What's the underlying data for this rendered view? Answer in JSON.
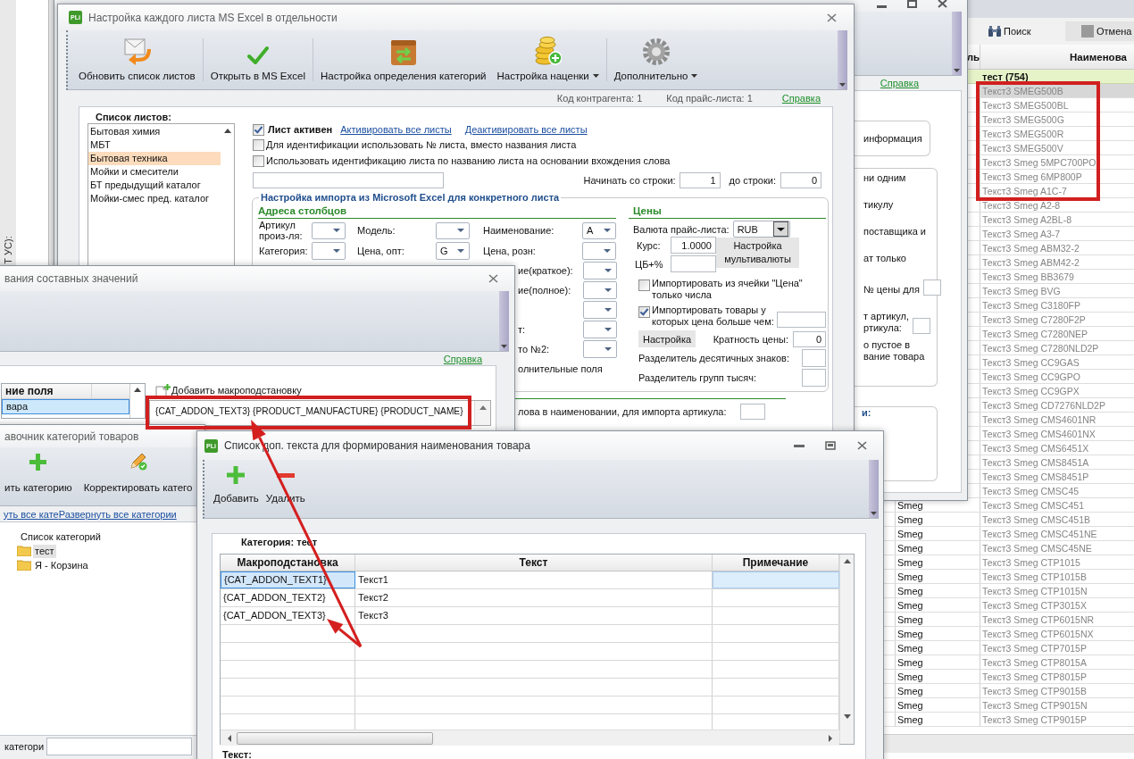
{
  "background_app": {
    "side_label": "Т УС):",
    "toolbar": [
      {
        "kind": "search",
        "label": "Поиск"
      },
      {
        "kind": "cancel",
        "label": "Отмена"
      }
    ],
    "table": {
      "columns": [
        "ль",
        "Наименова"
      ],
      "group_row": "тест (754)",
      "rows": [
        {
          "name": "Текст3 SMEG500B",
          "selected": true
        },
        {
          "name": "Текст3 SMEG500BL",
          "selected": false
        },
        {
          "name": "Текст3 SMEG500G",
          "selected": false
        },
        {
          "name": "Текст3 SMEG500R",
          "selected": false
        },
        {
          "name": "Текст3 SMEG500V",
          "selected": false
        },
        {
          "name": "Текст3 Smeg 5MPC700PO",
          "selected": false
        },
        {
          "name": "Текст3 Smeg 6MP800P",
          "selected": false
        },
        {
          "name": "Текст3 Smeg A1C-7",
          "selected": false
        },
        {
          "name": "Текст3 Smeg A2-8",
          "selected": false
        },
        {
          "name": "Текст3 Smeg A2BL-8",
          "selected": false
        },
        {
          "name": "Текст3 Smeg A3-7",
          "selected": false
        },
        {
          "name": "Текст3 Smeg ABM32-2",
          "selected": false
        },
        {
          "name": "Текст3 Smeg ABM42-2",
          "selected": false
        },
        {
          "name": "Текст3 Smeg BB3679",
          "selected": false
        },
        {
          "name": "Текст3 Smeg BVG",
          "selected": false
        },
        {
          "name": "Текст3 Smeg C3180FP",
          "selected": false
        },
        {
          "name": "Текст3 Smeg C7280F2P",
          "selected": false
        },
        {
          "name": "Текст3 Smeg C7280NEP",
          "selected": false
        },
        {
          "name": "Текст3 Smeg C7280NLD2P",
          "selected": false
        },
        {
          "name": "Текст3 Smeg CC9GAS",
          "selected": false
        },
        {
          "name": "Текст3 Smeg CC9GPO",
          "selected": false
        },
        {
          "name": "Текст3 Smeg CC9GPX",
          "selected": false
        },
        {
          "name": "Текст3 Smeg CD7276NLD2P",
          "selected": false
        },
        {
          "name": "Текст3 Smeg CMS4601NR",
          "selected": false
        },
        {
          "name": "Текст3 Smeg CMS4601NX",
          "selected": false
        },
        {
          "name": "Текст3 Smeg CMS6451X",
          "selected": false
        },
        {
          "name": "Текст3 Smeg CMS8451A",
          "selected": false
        },
        {
          "name": "Текст3 Smeg CMS8451P",
          "selected": false
        },
        {
          "name": "Текст3 Smeg CMSC45",
          "selected": false
        },
        {
          "manufacturer": "Smeg",
          "name": "Текст3 Smeg CMSC451",
          "selected": false
        },
        {
          "manufacturer": "Smeg",
          "name": "Текст3 Smeg CMSC451B",
          "selected": false
        },
        {
          "manufacturer": "Smeg",
          "name": "Текст3 Smeg CMSC451NE",
          "selected": false
        },
        {
          "manufacturer": "Smeg",
          "name": "Текст3 Smeg CMSC45NE",
          "selected": false
        },
        {
          "manufacturer": "Smeg",
          "name": "Текст3 Smeg CTP1015",
          "selected": false
        },
        {
          "manufacturer": "Smeg",
          "name": "Текст3 Smeg CTP1015B",
          "selected": false
        },
        {
          "manufacturer": "Smeg",
          "name": "Текст3 Smeg CTP1015N",
          "selected": false
        },
        {
          "manufacturer": "Smeg",
          "name": "Текст3 Smeg CTP3015X",
          "selected": false
        },
        {
          "manufacturer": "Smeg",
          "name": "Текст3 Smeg CTP6015NR",
          "selected": false
        },
        {
          "manufacturer": "Smeg",
          "name": "Текст3 Smeg CTP6015NX",
          "selected": false
        },
        {
          "manufacturer": "Smeg",
          "name": "Текст3 Smeg CTP7015P",
          "selected": false
        },
        {
          "manufacturer": "Smeg",
          "name": "Текст3 Smeg CTP8015A",
          "selected": false
        },
        {
          "manufacturer": "Smeg",
          "name": "Текст3 Smeg CTP8015P",
          "selected": false
        },
        {
          "manufacturer": "Smeg",
          "name": "Текст3 Smeg CTP9015B",
          "selected": false
        },
        {
          "manufacturer": "Smeg",
          "name": "Текст3 Smeg CTP9015N",
          "selected": false
        },
        {
          "manufacturer": "Smeg",
          "name": "Текст3 Smeg CTP9015P",
          "selected": false
        }
      ]
    }
  },
  "back_window": {
    "help_link": "Справка",
    "info_text": "информация",
    "options": [
      {
        "lines": [
          "ни одним"
        ],
        "field": false
      },
      {
        "lines": [
          "тикулу"
        ],
        "field": false
      },
      {
        "lines": [
          "поставщика и"
        ],
        "field": false
      },
      {
        "lines": [
          "ат только"
        ],
        "field": false
      },
      {
        "lines": [
          "№ цены для"
        ],
        "field": true
      },
      {
        "lines": [
          "т артикул,",
          "ртикула:"
        ],
        "field": true
      },
      {
        "lines": [
          "о пустое в",
          "вание товара"
        ],
        "field": false
      }
    ],
    "group_title": "и:"
  },
  "main_window": {
    "logo": "PLi",
    "title": "Настройка каждого листа MS Excel в отдельности",
    "toolbar": [
      {
        "kind": "refresh",
        "label": "Обновить список листов",
        "separated": false,
        "dropdown": false
      },
      {
        "kind": "open",
        "label": "Открыть в MS Excel",
        "separated": true,
        "dropdown": false
      },
      {
        "kind": "categories",
        "label": "Настройка определения категорий",
        "separated": true,
        "dropdown": false
      },
      {
        "kind": "markup",
        "label": "Настройка наценки",
        "separated": false,
        "dropdown": true
      },
      {
        "kind": "more",
        "label": "Дополнительно",
        "separated": true,
        "dropdown": true
      }
    ],
    "status": [
      "Код контрагента: 1",
      "Код прайс-листа: 1"
    ],
    "help_link": "Справка",
    "sheets": {
      "title": "Список листов:",
      "items": [
        {
          "label": "Бытовая химия",
          "selected": false
        },
        {
          "label": "МБТ",
          "selected": false
        },
        {
          "label": "Бытовая техника",
          "selected": true
        },
        {
          "label": "Мойки и смесители",
          "selected": false
        },
        {
          "label": "БТ предыдущий каталог",
          "selected": false
        },
        {
          "label": "Мойки-смес пред. каталог",
          "selected": false
        }
      ]
    },
    "sheet_active": {
      "label": "Лист активен",
      "checked": true
    },
    "links": [
      "Активировать все листы",
      "Деактивировать все листы"
    ],
    "options": [
      {
        "label": "Для идентификации использовать № листа, вместо названия листа",
        "checked": false
      },
      {
        "label": "Использовать идентификацию листа по названию листа на основании вхождения слова",
        "checked": false
      }
    ],
    "start_row": {
      "label": "Начинать со строки:",
      "value": "1"
    },
    "end_row": {
      "label": "до строки:",
      "value": "0"
    },
    "import": {
      "title": "Настройка импорта из Microsoft Excel для конкретного листа",
      "columns_title": "Адреса столбцов",
      "columns": [
        {
          "label": "Артикул произ-ля:"
        },
        {
          "label": "Модель:"
        },
        {
          "label": "Наименование:",
          "value": "A"
        },
        {
          "label": "Категория:"
        },
        {
          "label": "Цена, опт:",
          "value": "G"
        },
        {
          "label": "Цена, розн:"
        }
      ],
      "more_columns": [
        {
          "kind": "combo",
          "label": "ие(краткое):"
        },
        {
          "kind": "combo",
          "label": "ие(полное):"
        },
        {
          "kind": "combo"
        },
        {
          "kind": "combo",
          "label": "т:"
        },
        {
          "kind": "combo",
          "label": "то №2:"
        },
        {
          "kind": "text",
          "label": "олнительные поля"
        }
      ],
      "prices": {
        "title": "Цены",
        "currency": {
          "label": "Валюта прайс-листа:",
          "value": "RUB"
        },
        "rate": {
          "label": "Курс:",
          "value": "1.0000"
        },
        "cb_margin": {
          "label": "ЦБ+%"
        },
        "multicurrency_button": "Настройка мультивалюты",
        "only_numbers": {
          "label": "Импортировать из ячейки \"Цена\" только числа",
          "checked": false
        },
        "min_price": {
          "label": "Импортировать товары у которых цена больше чем:",
          "checked": true
        },
        "settings_button": "Настройка",
        "price_step": {
          "label": "Кратность цены:",
          "value": "0"
        },
        "decimal_separator": {
          "label": "Разделитель десятичных знаков:"
        },
        "group_separator": {
          "label": "Разделитель групп тысяч:"
        }
      }
    },
    "article_word": {
      "label": "лова в наименовании, для импорта артикула:"
    }
  },
  "composite_window": {
    "title": "вания составных значений",
    "help_link": "Справка",
    "fields": {
      "column": "ние поля",
      "rows": [
        {
          "label": "вара",
          "selected": true
        }
      ]
    },
    "add_macro": "Добавить макроподстановку",
    "template": "{CAT_ADDON_TEXT3} {PRODUCT_MANUFACTURE} {PRODUCT_NAME}"
  },
  "category_window": {
    "title": "авочник категорий товаров",
    "toolbar": [
      {
        "kind": "add",
        "label": "ить категорию"
      },
      {
        "kind": "edit",
        "label": "Корректировать катего"
      }
    ],
    "links": [
      "уть все кате",
      "Развернуть все категории"
    ],
    "tree": {
      "label": "Список категорий",
      "selected": false,
      "children": [
        {
          "label": "тест",
          "selected": true
        },
        {
          "label": "Я - Корзина",
          "selected": false
        }
      ]
    },
    "search_label": "категори"
  },
  "addon_window": {
    "logo": "PLi",
    "title": "Список доп. текста для формирования наименования товара",
    "toolbar": [
      {
        "kind": "add",
        "label": "Добавить"
      },
      {
        "kind": "delete",
        "label": "Удалить"
      }
    ],
    "category_label": "Категория: тест",
    "table": {
      "columns": [
        "Макроподстановка",
        "Текст",
        "Примечание"
      ],
      "rows": [
        {
          "macro": "{CAT_ADDON_TEXT1}",
          "text": "Текст1",
          "selected": true
        },
        {
          "macro": "{CAT_ADDON_TEXT2}",
          "text": "Текст2",
          "selected": false
        },
        {
          "macro": "{CAT_ADDON_TEXT3}",
          "text": "Текст3",
          "selected": false
        }
      ]
    },
    "text_label": "Текст:"
  }
}
